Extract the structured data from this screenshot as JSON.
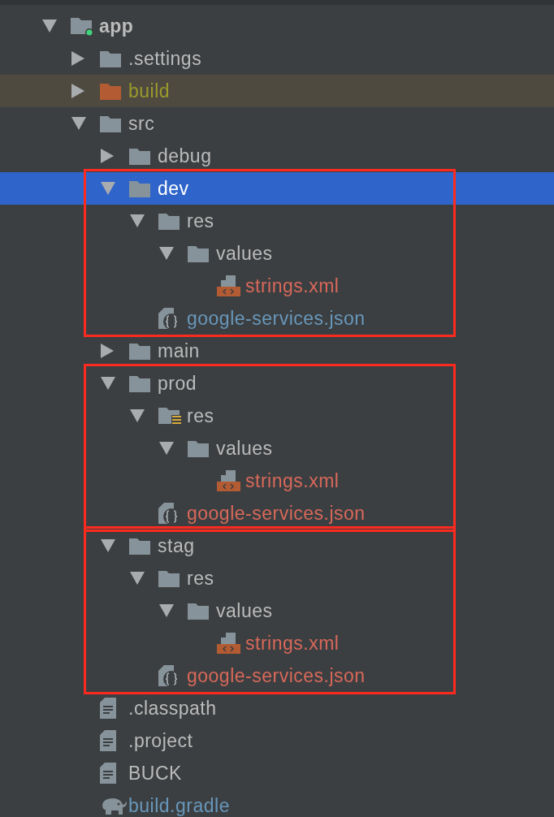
{
  "project_tree": [
    {
      "label": "app",
      "kind": "module",
      "color": "#bbbbbb",
      "expanded": true,
      "selected": false,
      "boxed": false,
      "children": [
        {
          "label": ".settings",
          "kind": "folder",
          "color": "#bbbbbb",
          "expanded": false,
          "selected": false,
          "boxed": false
        },
        {
          "label": "build",
          "kind": "excluded-folder",
          "color": "#9a9a2c",
          "expanded": false,
          "selected": false,
          "boxed": false
        },
        {
          "label": "src",
          "kind": "folder",
          "color": "#bbbbbb",
          "expanded": true,
          "selected": false,
          "boxed": false,
          "children": [
            {
              "label": "debug",
              "kind": "folder",
              "color": "#bbbbbb",
              "expanded": false,
              "selected": false,
              "boxed": false
            },
            {
              "label": "dev",
              "kind": "folder",
              "color": "#ffffff",
              "expanded": true,
              "selected": true,
              "boxed": true,
              "children": [
                {
                  "label": "res",
                  "kind": "folder",
                  "color": "#bbbbbb",
                  "expanded": true,
                  "selected": false,
                  "boxed": false,
                  "children": [
                    {
                      "label": "values",
                      "kind": "folder",
                      "color": "#bbbbbb",
                      "expanded": true,
                      "selected": false,
                      "boxed": false,
                      "children": [
                        {
                          "label": "strings.xml",
                          "kind": "xml",
                          "color": "#d8685a",
                          "selected": false,
                          "boxed": false
                        }
                      ]
                    }
                  ]
                },
                {
                  "label": "google-services.json",
                  "kind": "json",
                  "color": "#6897bb",
                  "selected": false,
                  "boxed": false
                }
              ]
            },
            {
              "label": "main",
              "kind": "folder",
              "color": "#bbbbbb",
              "expanded": false,
              "selected": false,
              "boxed": false
            },
            {
              "label": "prod",
              "kind": "folder",
              "color": "#bbbbbb",
              "expanded": true,
              "selected": false,
              "boxed": true,
              "children": [
                {
                  "label": "res",
                  "kind": "res-folder",
                  "color": "#bbbbbb",
                  "expanded": true,
                  "selected": false,
                  "boxed": false,
                  "children": [
                    {
                      "label": "values",
                      "kind": "folder",
                      "color": "#bbbbbb",
                      "expanded": true,
                      "selected": false,
                      "boxed": false,
                      "children": [
                        {
                          "label": "strings.xml",
                          "kind": "xml",
                          "color": "#d8685a",
                          "selected": false,
                          "boxed": false
                        }
                      ]
                    }
                  ]
                },
                {
                  "label": "google-services.json",
                  "kind": "json",
                  "color": "#d8685a",
                  "selected": false,
                  "boxed": false
                }
              ]
            },
            {
              "label": "stag",
              "kind": "folder",
              "color": "#bbbbbb",
              "expanded": true,
              "selected": false,
              "boxed": true,
              "children": [
                {
                  "label": "res",
                  "kind": "folder",
                  "color": "#bbbbbb",
                  "expanded": true,
                  "selected": false,
                  "boxed": false,
                  "children": [
                    {
                      "label": "values",
                      "kind": "folder",
                      "color": "#bbbbbb",
                      "expanded": true,
                      "selected": false,
                      "boxed": false,
                      "children": [
                        {
                          "label": "strings.xml",
                          "kind": "xml",
                          "color": "#d8685a",
                          "selected": false,
                          "boxed": false
                        }
                      ]
                    }
                  ]
                },
                {
                  "label": "google-services.json",
                  "kind": "json",
                  "color": "#d8685a",
                  "selected": false,
                  "boxed": false
                }
              ]
            }
          ]
        },
        {
          "label": ".classpath",
          "kind": "text-file",
          "color": "#bbbbbb",
          "selected": false,
          "boxed": false
        },
        {
          "label": ".project",
          "kind": "text-file",
          "color": "#bbbbbb",
          "selected": false,
          "boxed": false
        },
        {
          "label": "BUCK",
          "kind": "text-file",
          "color": "#bbbbbb",
          "selected": false,
          "boxed": false
        },
        {
          "label": "build.gradle",
          "kind": "gradle",
          "color": "#6897bb",
          "selected": false,
          "boxed": false
        }
      ]
    }
  ]
}
